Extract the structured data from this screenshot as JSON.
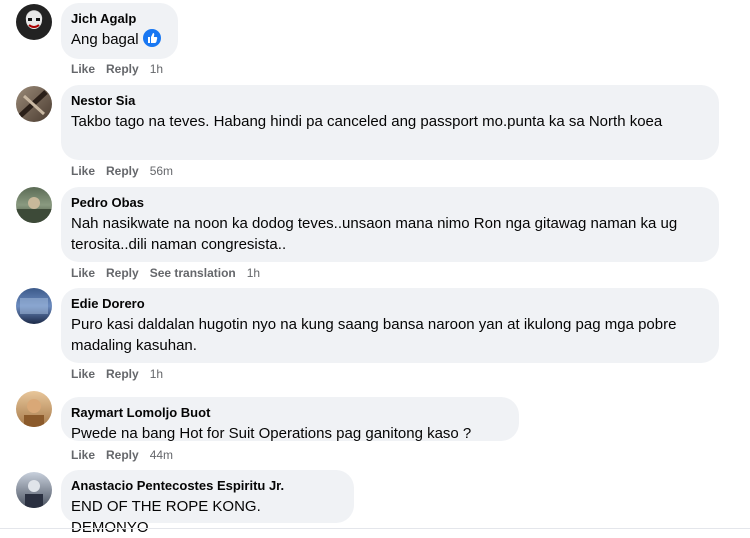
{
  "comments": [
    {
      "author": "Jich Agalp",
      "text": "Ang bagal",
      "actions": {
        "like": "Like",
        "reply": "Reply",
        "time": "1h"
      },
      "reaction": "like-icon"
    },
    {
      "author": "Nestor Sia",
      "text": "Takbo tago na teves. Habang hindi pa canceled ang passport mo.punta ka sa North koea",
      "actions": {
        "like": "Like",
        "reply": "Reply",
        "time": "56m"
      }
    },
    {
      "author": "Pedro Obas",
      "text": "Nah nasikwate na noon ka dodog teves..unsaon mana nimo Ron nga gitawag naman ka ug terosita..dili naman congresista..",
      "actions": {
        "like": "Like",
        "reply": "Reply",
        "see_translation": "See translation",
        "time": "1h"
      }
    },
    {
      "author": "Edie Dorero",
      "text": "Puro kasi daldalan hugotin nyo na kung saang bansa naroon yan at ikulong pag mga pobre madaling kasuhan.",
      "actions": {
        "like": "Like",
        "reply": "Reply",
        "time": "1h"
      }
    },
    {
      "author": "Raymart Lomoljo Buot",
      "text": "Pwede na bang Hot for Suit Operations pag ganitong kaso ?",
      "actions": {
        "like": "Like",
        "reply": "Reply",
        "time": "44m"
      }
    },
    {
      "author": "Anastacio Pentecostes Espiritu Jr.",
      "text": "END OF THE ROPE KONG. DEMONYO"
    }
  ],
  "colors": {
    "bubble": "#f0f2f5",
    "meta": "#65676b",
    "like_blue": "#1877f2"
  }
}
